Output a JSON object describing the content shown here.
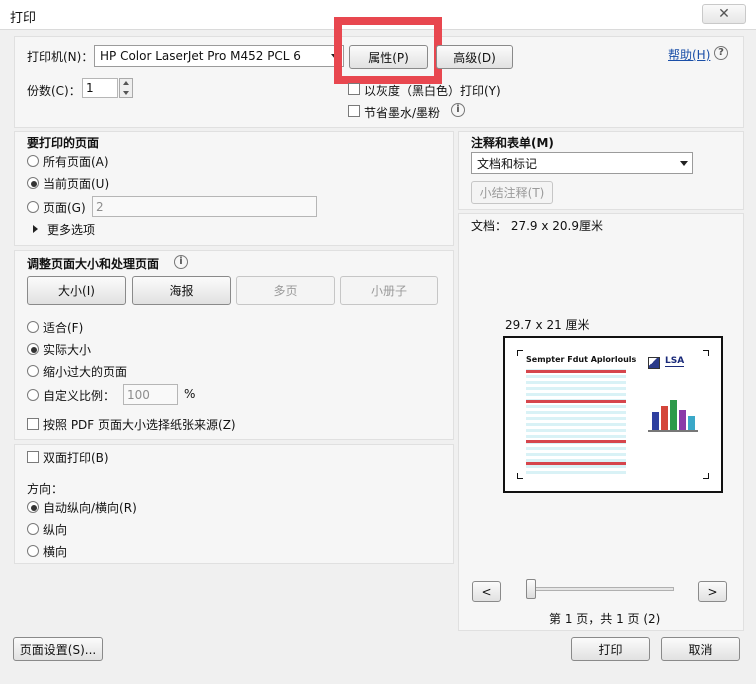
{
  "window": {
    "title": "打印",
    "close_glyph": "✕"
  },
  "printer": {
    "label": "打印机(N)：",
    "selected": "HP Color LaserJet Pro M452 PCL 6",
    "properties_button": "属性(P)",
    "advanced_button": "高级(D)",
    "help_link": "帮助(H)",
    "help_icon": "help-circle-icon"
  },
  "copies": {
    "label": "份数(C)：",
    "value": "1"
  },
  "options": {
    "grayscale_label": "以灰度（黑白色）打印(Y)",
    "save_ink_label": "节省墨水/墨粉",
    "highlight_color": "#e8474f"
  },
  "pages": {
    "heading": "要打印的页面",
    "all": "所有页面(A)",
    "current": "当前页面(U)",
    "range_label": "页面(G)",
    "range_value": "2",
    "more": "更多选项"
  },
  "sizing": {
    "heading": "调整页面大小和处理页面",
    "buttons": [
      "大小(I)",
      "海报",
      "多页",
      "小册子"
    ],
    "fit": "适合(F)",
    "actual": "实际大小",
    "shrink": "缩小过大的页面",
    "custom": "自定义比例：",
    "custom_value": "100",
    "percent": "%",
    "pdf_source": "按照 PDF 页面大小选择纸张来源(Z)"
  },
  "duplex": {
    "label": "双面打印(B)"
  },
  "orientation": {
    "heading": "方向：",
    "auto": "自动纵向/横向(R)",
    "portrait": "纵向",
    "landscape": "横向"
  },
  "comments": {
    "heading": "注释和表单(M)",
    "selected": "文档和标记",
    "summarize_button": "小结注释(T)"
  },
  "preview": {
    "doc_label": "文档： 27.9 x 20.9厘米",
    "paper_label": "29.7 x 21 厘米",
    "sheet_title": "Sempter Fdut Aplorlouls",
    "sheet_logo": "LSA",
    "prev": "<",
    "next": ">",
    "page_info": "第 1 页，共 1 页 (2)"
  },
  "footer": {
    "page_setup": "页面设置(S)...",
    "print": "打印",
    "cancel": "取消"
  }
}
